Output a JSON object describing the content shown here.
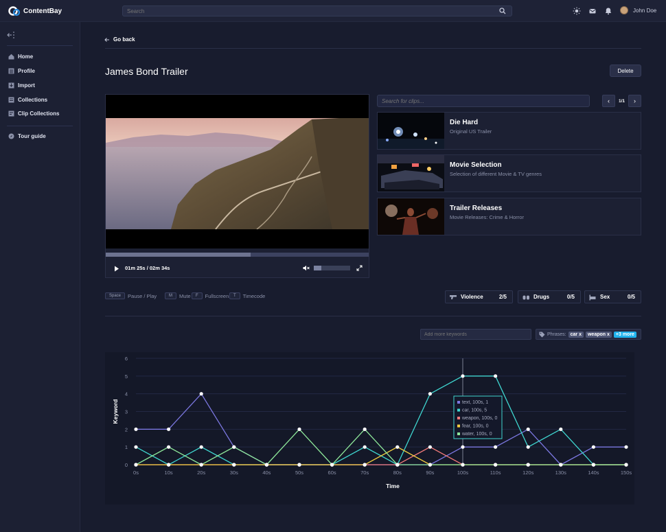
{
  "app": {
    "name": "ContentBay"
  },
  "topbar": {
    "search_placeholder": "Search",
    "user_name": "John Doe"
  },
  "sidebar": {
    "items": [
      {
        "label": "Home",
        "icon": "home-icon"
      },
      {
        "label": "Profile",
        "icon": "profile-icon"
      },
      {
        "label": "Import",
        "icon": "import-icon"
      },
      {
        "label": "Collections",
        "icon": "collections-icon"
      },
      {
        "label": "Clip Collections",
        "icon": "clip-collections-icon"
      }
    ],
    "tour": "Tour guide"
  },
  "page": {
    "back_label": "Go back",
    "title": "James Bond Trailer",
    "delete_label": "Delete"
  },
  "player": {
    "time": "01m 25s / 02m 34s",
    "progress": 0.55,
    "volume": 0.2
  },
  "clips": {
    "search_placeholder": "Search for clips...",
    "pagination": "1/1",
    "items": [
      {
        "title": "Die Hard",
        "subtitle": "Original US Trailer"
      },
      {
        "title": "Movie Selection",
        "subtitle": "Selection of different Movie & TV genres"
      },
      {
        "title": "Trailer Releases",
        "subtitle": "Movie Releases: Crime & Horror"
      }
    ]
  },
  "shortcuts": [
    {
      "key": "Space",
      "label": "Pause / Play"
    },
    {
      "key": "M",
      "label": "Mute"
    },
    {
      "key": "F",
      "label": "Fullscreen"
    },
    {
      "key": "T",
      "label": "Timecode"
    }
  ],
  "ratings": [
    {
      "label": "Violence",
      "value": "2/5"
    },
    {
      "label": "Drugs",
      "value": "0/5"
    },
    {
      "label": "Sex",
      "value": "0/5"
    }
  ],
  "keywords": {
    "placeholder": "Add more keywords",
    "phrases_label": "Phrases:",
    "tags": [
      "car x",
      "weapon x"
    ],
    "more": "+3 more"
  },
  "colors": {
    "text": "#7b77e0",
    "car": "#3fd6d0",
    "weapon": "#f27a7a",
    "fear": "#f5d040",
    "water": "#8ee89a",
    "accent": "#1fb3ee"
  },
  "chart_data": {
    "type": "line",
    "xlabel": "Time",
    "ylabel": "Keyword",
    "x": [
      "0s",
      "10s",
      "20s",
      "30s",
      "40s",
      "50s",
      "60s",
      "70s",
      "80s",
      "90s",
      "100s",
      "110s",
      "120s",
      "130s",
      "140s",
      "150s"
    ],
    "ylim": [
      0,
      6
    ],
    "yticks": [
      0,
      1,
      2,
      3,
      4,
      5,
      6
    ],
    "series": [
      {
        "name": "text",
        "values": [
          2,
          2,
          4,
          1,
          0,
          0,
          0,
          0,
          0,
          0,
          1,
          1,
          2,
          0,
          1,
          1
        ]
      },
      {
        "name": "car",
        "values": [
          1,
          0,
          1,
          0,
          0,
          0,
          0,
          1,
          0,
          4,
          5,
          5,
          1,
          2,
          0,
          0
        ]
      },
      {
        "name": "weapon",
        "values": [
          0,
          0,
          0,
          0,
          0,
          0,
          0,
          0,
          0,
          1,
          0,
          0,
          0,
          0,
          0,
          0
        ]
      },
      {
        "name": "fear",
        "values": [
          0,
          0,
          0,
          0,
          0,
          0,
          0,
          0,
          1,
          0,
          0,
          0,
          0,
          0,
          0,
          0
        ]
      },
      {
        "name": "water",
        "values": [
          0,
          1,
          0,
          1,
          0,
          2,
          0,
          2,
          0,
          0,
          0,
          0,
          0,
          0,
          0,
          0
        ]
      }
    ],
    "tooltip": {
      "x": "100s",
      "lines": [
        "text, 100s, 1",
        "car, 100s, 5",
        "weapon, 100s, 0",
        "fear, 100s, 0",
        "water, 100s, 0"
      ]
    }
  }
}
